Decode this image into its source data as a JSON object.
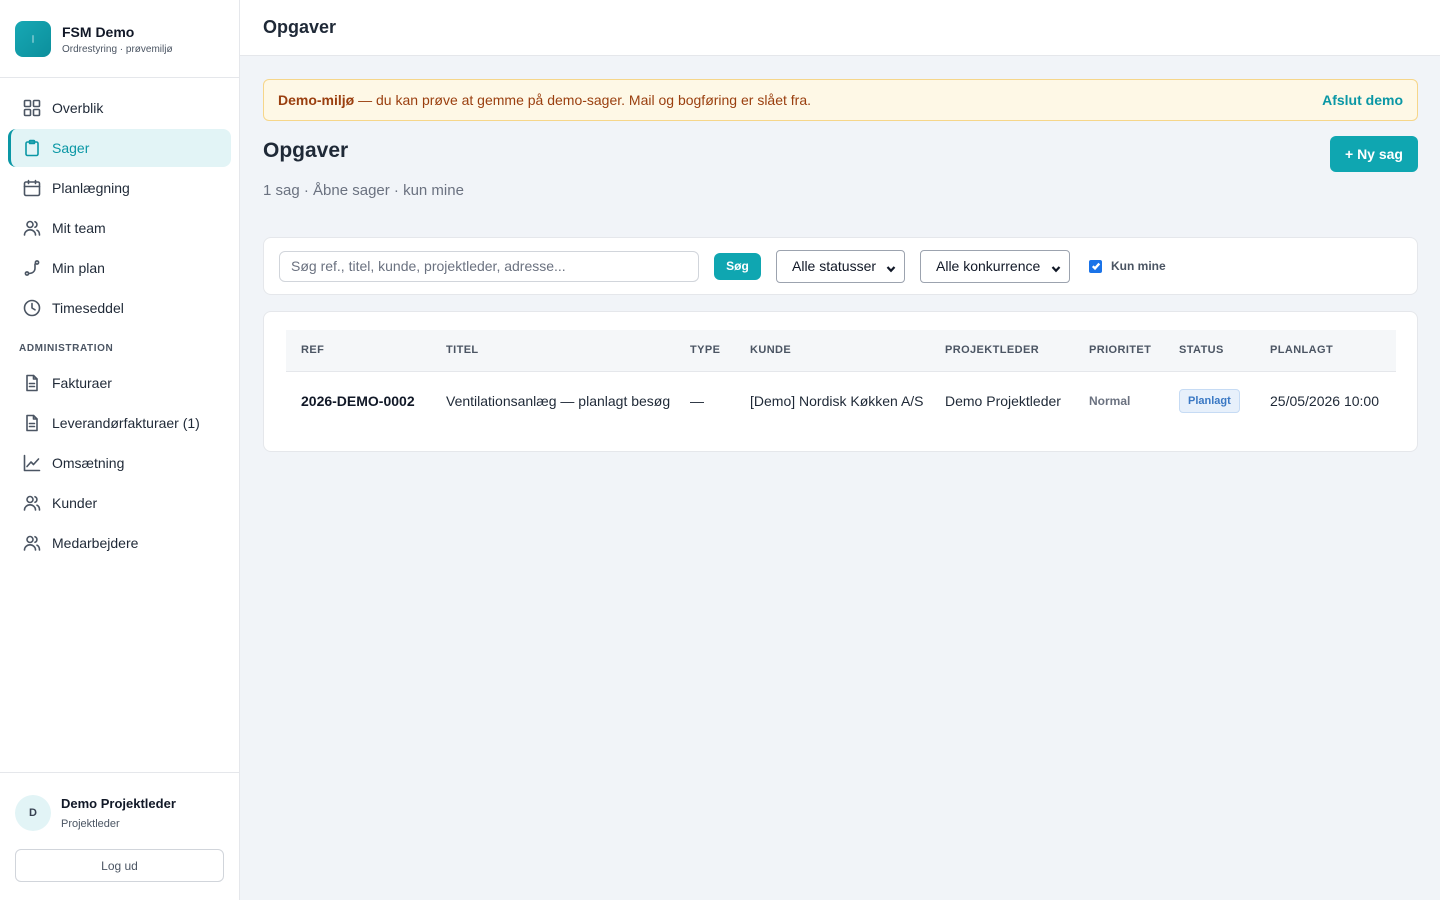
{
  "brand": {
    "title": "FSM Demo",
    "subtitle": "Ordrestyring · prøvemiljø"
  },
  "sidebar": {
    "items": [
      {
        "label": "Overblik",
        "icon": "grid-icon"
      },
      {
        "label": "Sager",
        "icon": "clipboard-icon",
        "active": true
      },
      {
        "label": "Planlægning",
        "icon": "calendar-icon"
      },
      {
        "label": "Mit team",
        "icon": "users-icon"
      },
      {
        "label": "Min plan",
        "icon": "route-icon"
      },
      {
        "label": "Timeseddel",
        "icon": "clock-icon"
      }
    ],
    "section_label": "ADMINISTRATION",
    "admin_items": [
      {
        "label": "Fakturaer",
        "icon": "document-icon"
      },
      {
        "label": "Leverandørfakturaer (1)",
        "icon": "document-icon"
      },
      {
        "label": "Omsætning",
        "icon": "chart-icon"
      },
      {
        "label": "Kunder",
        "icon": "users-icon"
      },
      {
        "label": "Medarbejdere",
        "icon": "users-icon"
      }
    ]
  },
  "user": {
    "initial": "D",
    "name": "Demo Projektleder",
    "role": "Projektleder",
    "logout_label": "Log ud"
  },
  "topbar": {
    "title": "Opgaver"
  },
  "banner": {
    "strong": "Demo-miljø",
    "text": " — du kan prøve at gemme på demo-sager. Mail og bogføring er slået fra.",
    "action": "Afslut demo"
  },
  "page": {
    "title": "Opgaver",
    "subtitle": "1 sag · Åbne sager · kun mine",
    "new_button": "+ Ny sag"
  },
  "filters": {
    "search_placeholder": "Søg ref., titel, kunde, projektleder, adresse...",
    "search_value": "",
    "search_button": "Søg",
    "status_select": "Alle statusser",
    "competition_select": "Alle konkurrence",
    "only_mine_label": "Kun mine",
    "only_mine_checked": true
  },
  "table": {
    "columns": [
      "REF",
      "TITEL",
      "TYPE",
      "KUNDE",
      "PROJEKTLEDER",
      "PRIORITET",
      "STATUS",
      "PLANLAGT"
    ],
    "rows": [
      {
        "ref": "2026-DEMO-0002",
        "title": "Ventilationsanlæg — planlagt besøg",
        "type": "—",
        "customer": "[Demo] Nordisk Køkken A/S",
        "manager": "Demo Projektleder",
        "priority": "Normal",
        "status": "Planlagt",
        "planned": "25/05/2026 10:00"
      }
    ]
  },
  "colors": {
    "accent": "#0fa6b1",
    "banner_bg": "#fef8e6",
    "badge_text": "#3a78c4"
  }
}
